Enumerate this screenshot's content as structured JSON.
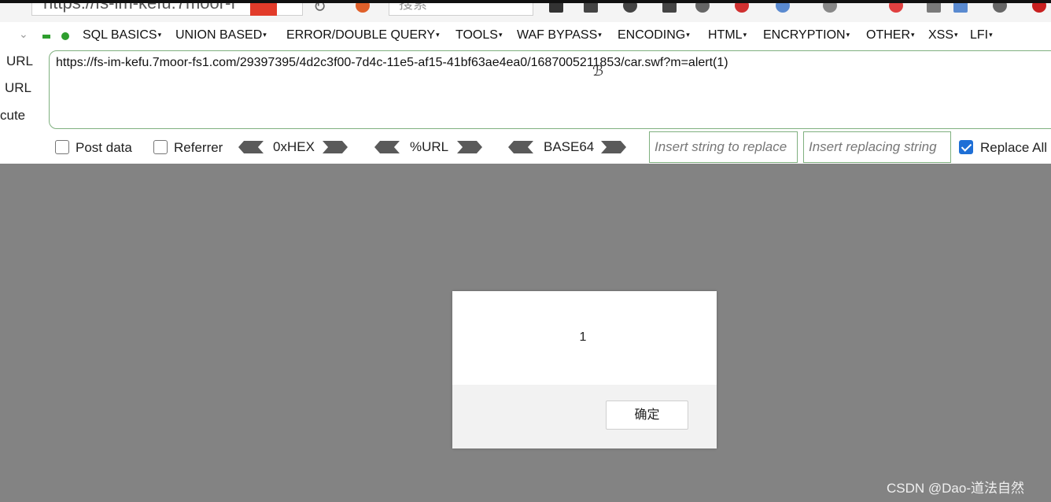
{
  "browser": {
    "address_partial": "https://fs-im-kefu.7moor-f",
    "search_placeholder": "搜索"
  },
  "hackbar": {
    "menu": [
      "SQL BASICS",
      "UNION BASED",
      "ERROR/DOUBLE QUERY",
      "TOOLS",
      "WAF BYPASS",
      "ENCODING",
      "HTML",
      "ENCRYPTION",
      "OTHER",
      "XSS",
      "LFI"
    ],
    "side_labels": [
      "URL",
      "URL",
      "cute"
    ],
    "url_value": "https://fs-im-kefu.7moor-fs1.com/29397395/4d2c3f00-7d4c-11e5-af15-41bf63ae4ea0/1687005211853/car.swf?m=alert(1)",
    "post_data_label": "Post data",
    "referrer_label": "Referrer",
    "hex_label": "0xHEX",
    "url_enc_label": "%URL",
    "base64_label": "BASE64",
    "insert_placeholder": "Insert string to replace",
    "replacing_placeholder": "Insert replacing string",
    "replace_all_label": "Replace All",
    "replace_all_checked": true
  },
  "dialog": {
    "message": "1",
    "ok_label": "确定"
  },
  "watermark": "CSDN @Dao-道法自然"
}
